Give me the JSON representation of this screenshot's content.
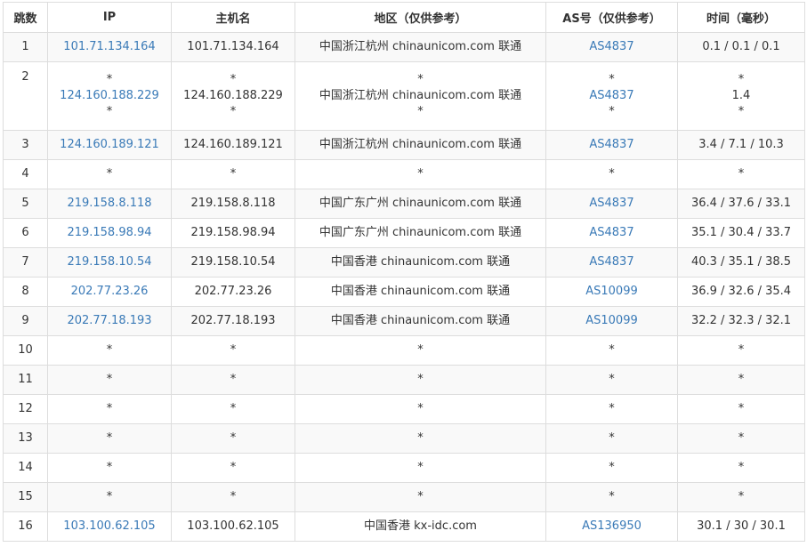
{
  "header": {
    "hop": "跳数",
    "ip": "IP",
    "host": "主机名",
    "region": "地区（仅供参考）",
    "as": "AS号（仅供参考）",
    "time": "时间（毫秒）"
  },
  "rows": [
    {
      "hop": "1",
      "ip": [
        "101.71.134.164"
      ],
      "host": [
        "101.71.134.164"
      ],
      "region": [
        "中国浙江杭州 chinaunicom.com 联通"
      ],
      "as": [
        "AS4837"
      ],
      "time": [
        "0.1 / 0.1 / 0.1"
      ]
    },
    {
      "hop": "2",
      "ip": [
        "*",
        "124.160.188.229",
        "*"
      ],
      "host": [
        "*",
        "124.160.188.229",
        "*"
      ],
      "region": [
        "*",
        "中国浙江杭州 chinaunicom.com 联通",
        "*"
      ],
      "as": [
        "*",
        "AS4837",
        "*"
      ],
      "time": [
        "*",
        "1.4",
        "*"
      ]
    },
    {
      "hop": "3",
      "ip": [
        "124.160.189.121"
      ],
      "host": [
        "124.160.189.121"
      ],
      "region": [
        "中国浙江杭州 chinaunicom.com 联通"
      ],
      "as": [
        "AS4837"
      ],
      "time": [
        "3.4 / 7.1 / 10.3"
      ]
    },
    {
      "hop": "4",
      "ip": [
        "*"
      ],
      "host": [
        "*"
      ],
      "region": [
        "*"
      ],
      "as": [
        "*"
      ],
      "time": [
        "*"
      ]
    },
    {
      "hop": "5",
      "ip": [
        "219.158.8.118"
      ],
      "host": [
        "219.158.8.118"
      ],
      "region": [
        "中国广东广州 chinaunicom.com 联通"
      ],
      "as": [
        "AS4837"
      ],
      "time": [
        "36.4 / 37.6 / 33.1"
      ]
    },
    {
      "hop": "6",
      "ip": [
        "219.158.98.94"
      ],
      "host": [
        "219.158.98.94"
      ],
      "region": [
        "中国广东广州 chinaunicom.com 联通"
      ],
      "as": [
        "AS4837"
      ],
      "time": [
        "35.1 / 30.4 / 33.7"
      ]
    },
    {
      "hop": "7",
      "ip": [
        "219.158.10.54"
      ],
      "host": [
        "219.158.10.54"
      ],
      "region": [
        "中国香港 chinaunicom.com 联通"
      ],
      "as": [
        "AS4837"
      ],
      "time": [
        "40.3 / 35.1 / 38.5"
      ]
    },
    {
      "hop": "8",
      "ip": [
        "202.77.23.26"
      ],
      "host": [
        "202.77.23.26"
      ],
      "region": [
        "中国香港 chinaunicom.com 联通"
      ],
      "as": [
        "AS10099"
      ],
      "time": [
        "36.9 / 32.6 / 35.4"
      ]
    },
    {
      "hop": "9",
      "ip": [
        "202.77.18.193"
      ],
      "host": [
        "202.77.18.193"
      ],
      "region": [
        "中国香港 chinaunicom.com 联通"
      ],
      "as": [
        "AS10099"
      ],
      "time": [
        "32.2 / 32.3 / 32.1"
      ]
    },
    {
      "hop": "10",
      "ip": [
        "*"
      ],
      "host": [
        "*"
      ],
      "region": [
        "*"
      ],
      "as": [
        "*"
      ],
      "time": [
        "*"
      ]
    },
    {
      "hop": "11",
      "ip": [
        "*"
      ],
      "host": [
        "*"
      ],
      "region": [
        "*"
      ],
      "as": [
        "*"
      ],
      "time": [
        "*"
      ]
    },
    {
      "hop": "12",
      "ip": [
        "*"
      ],
      "host": [
        "*"
      ],
      "region": [
        "*"
      ],
      "as": [
        "*"
      ],
      "time": [
        "*"
      ]
    },
    {
      "hop": "13",
      "ip": [
        "*"
      ],
      "host": [
        "*"
      ],
      "region": [
        "*"
      ],
      "as": [
        "*"
      ],
      "time": [
        "*"
      ]
    },
    {
      "hop": "14",
      "ip": [
        "*"
      ],
      "host": [
        "*"
      ],
      "region": [
        "*"
      ],
      "as": [
        "*"
      ],
      "time": [
        "*"
      ]
    },
    {
      "hop": "15",
      "ip": [
        "*"
      ],
      "host": [
        "*"
      ],
      "region": [
        "*"
      ],
      "as": [
        "*"
      ],
      "time": [
        "*"
      ]
    },
    {
      "hop": "16",
      "ip": [
        "103.100.62.105"
      ],
      "host": [
        "103.100.62.105"
      ],
      "region": [
        "中国香港 kx-idc.com"
      ],
      "as": [
        "AS136950"
      ],
      "time": [
        "30.1 / 30 / 30.1"
      ]
    }
  ]
}
